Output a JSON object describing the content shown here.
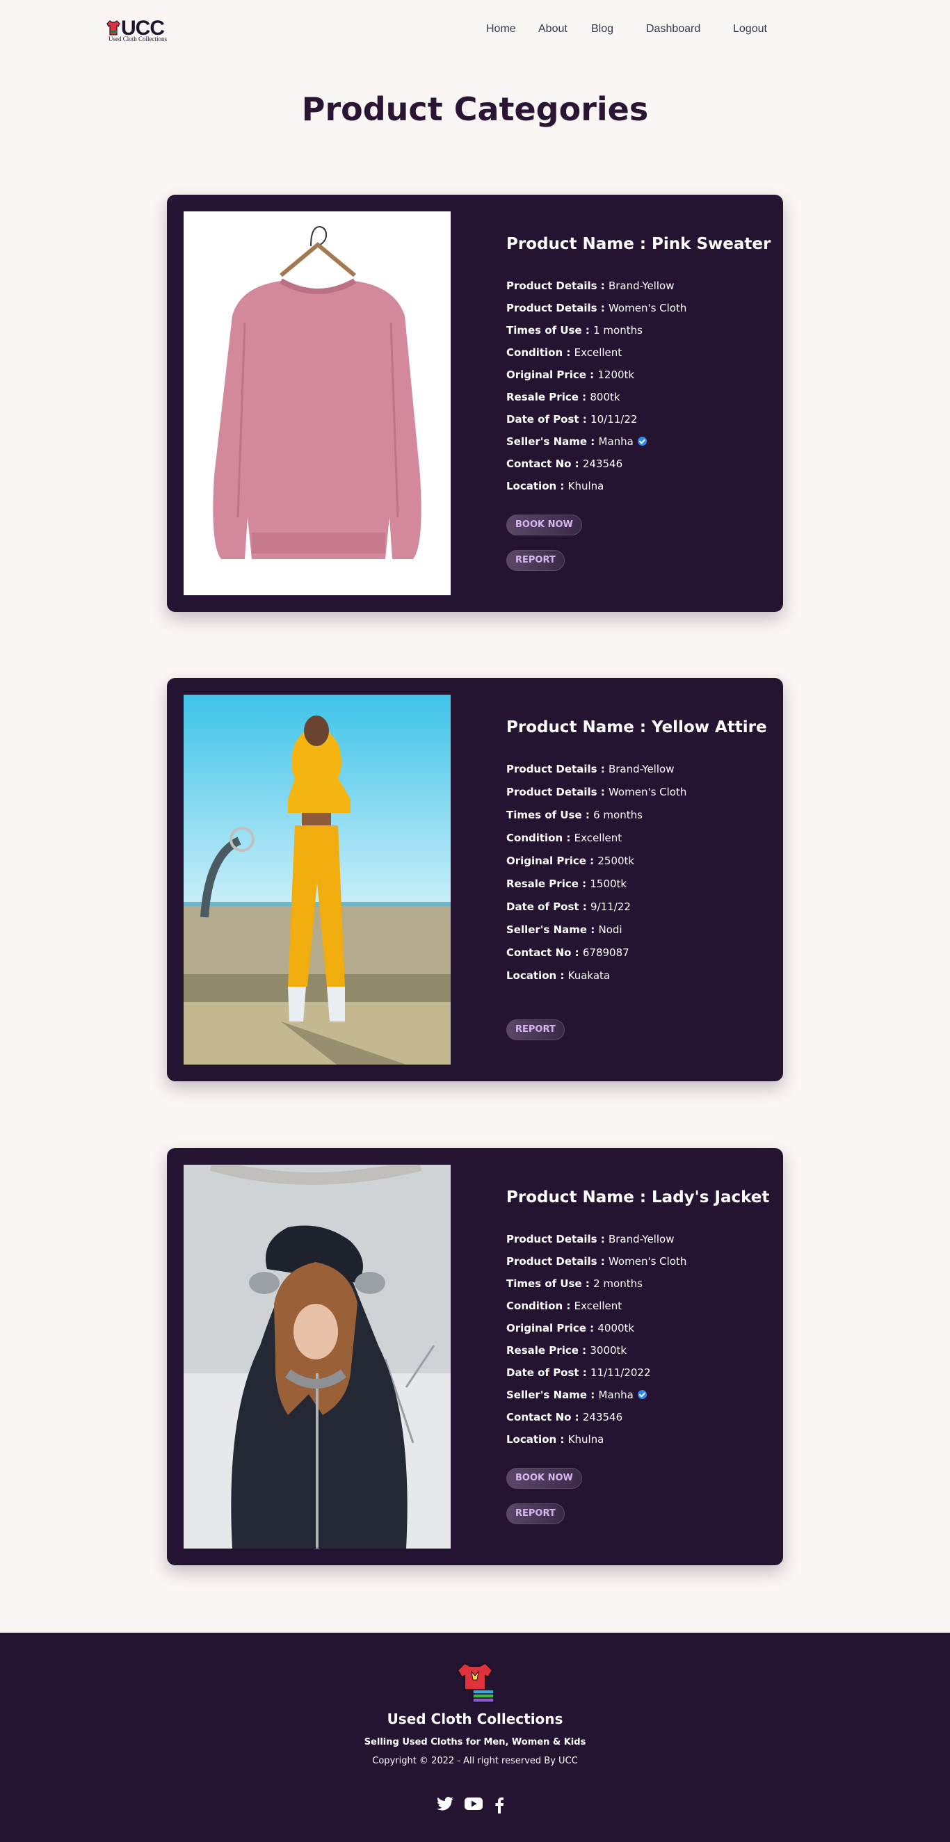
{
  "nav": {
    "logo_text": "UCC",
    "logo_tagline": "Used Cloth Collections",
    "links": [
      "Home",
      "About",
      "Blog",
      "Dashboard",
      "Logout"
    ]
  },
  "page_title": "Product Categories",
  "labels": {
    "product_name": "Product Name : ",
    "product_details": "Product Details : ",
    "times_of_use": "Times of Use : ",
    "condition": "Condition : ",
    "original_price": "Original Price : ",
    "resale_price": "Resale Price : ",
    "date_of_post": "Date of Post : ",
    "seller_name": "Seller's Name : ",
    "contact_no": "Contact No : ",
    "location": "Location : ",
    "book_now": "BOOK NOW",
    "report": "REPORT"
  },
  "products": [
    {
      "name": "Pink Sweater",
      "details_brand": "Brand-Yellow",
      "details_type": "Women's Cloth",
      "times_of_use": "1 months",
      "condition": "Excellent",
      "original_price": "1200tk",
      "resale_price": "800tk",
      "date_of_post": "10/11/22",
      "seller_name": "Manha",
      "seller_verified": true,
      "contact_no": "243546",
      "location": "Khulna",
      "bookable": true,
      "image": "pink-sweater-on-hanger"
    },
    {
      "name": "Yellow Attire",
      "details_brand": "Brand-Yellow",
      "details_type": "Women's Cloth",
      "times_of_use": "6 months",
      "condition": "Excellent",
      "original_price": "2500tk",
      "resale_price": "1500tk",
      "date_of_post": "9/11/22",
      "seller_name": "Nodi",
      "seller_verified": false,
      "contact_no": "6789087",
      "location": "Kuakata",
      "bookable": false,
      "image": "woman-in-yellow-outfit"
    },
    {
      "name": "Lady's Jacket",
      "details_brand": "Brand-Yellow",
      "details_type": "Women's Cloth",
      "times_of_use": "2 months",
      "condition": "Excellent",
      "original_price": "4000tk",
      "resale_price": "3000tk",
      "date_of_post": "11/11/2022",
      "seller_name": "Manha",
      "seller_verified": true,
      "contact_no": "243546",
      "location": "Khulna",
      "bookable": true,
      "image": "woman-in-black-jacket"
    }
  ],
  "footer": {
    "title": "Used Cloth Collections",
    "subtitle": "Selling Used Cloths for Men, Women & Kids",
    "copyright": "Copyright © 2022 - All right reserved By UCC",
    "social": [
      "twitter-icon",
      "youtube-icon",
      "facebook-icon"
    ]
  },
  "colors": {
    "background": "#faf6f3",
    "card": "#241331",
    "title": "#2a1534",
    "button_text": "#d9b6ef",
    "verified": "#2e8bf0"
  }
}
